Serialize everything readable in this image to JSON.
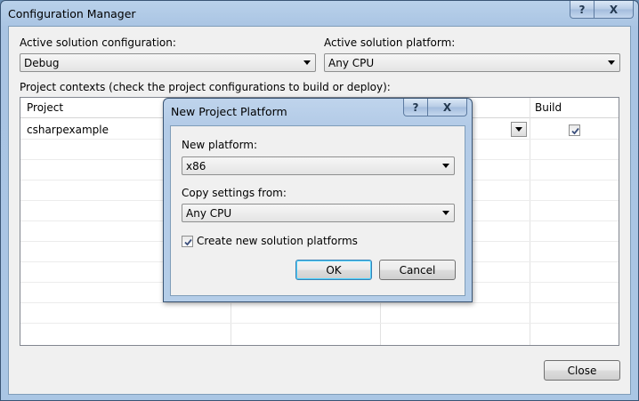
{
  "window": {
    "title": "Configuration Manager",
    "help_glyph": "?",
    "close_glyph": "X"
  },
  "active_configuration": {
    "label": "Active solution configuration:",
    "value": "Debug"
  },
  "active_platform": {
    "label": "Active solution platform:",
    "value": "Any CPU"
  },
  "project_contexts": {
    "label": "Project contexts (check the project configurations to build or deploy):",
    "columns": {
      "project": "Project",
      "build": "Build"
    },
    "rows": [
      {
        "project": "csharpexample",
        "build": true
      }
    ]
  },
  "close_button": "Close",
  "dialog": {
    "title": "New Project Platform",
    "help_glyph": "?",
    "close_glyph": "X",
    "new_platform_label": "New platform:",
    "new_platform_value": "x86",
    "copy_from_label": "Copy settings from:",
    "copy_from_value": "Any CPU",
    "create_solution_platforms_label": "Create new solution platforms",
    "create_solution_platforms_checked": true,
    "ok_label": "OK",
    "cancel_label": "Cancel"
  },
  "colors": {
    "title_bar": "#b9d1ea",
    "client_bg": "#f0f0f0",
    "default_button_border": "#3c7fb1"
  }
}
